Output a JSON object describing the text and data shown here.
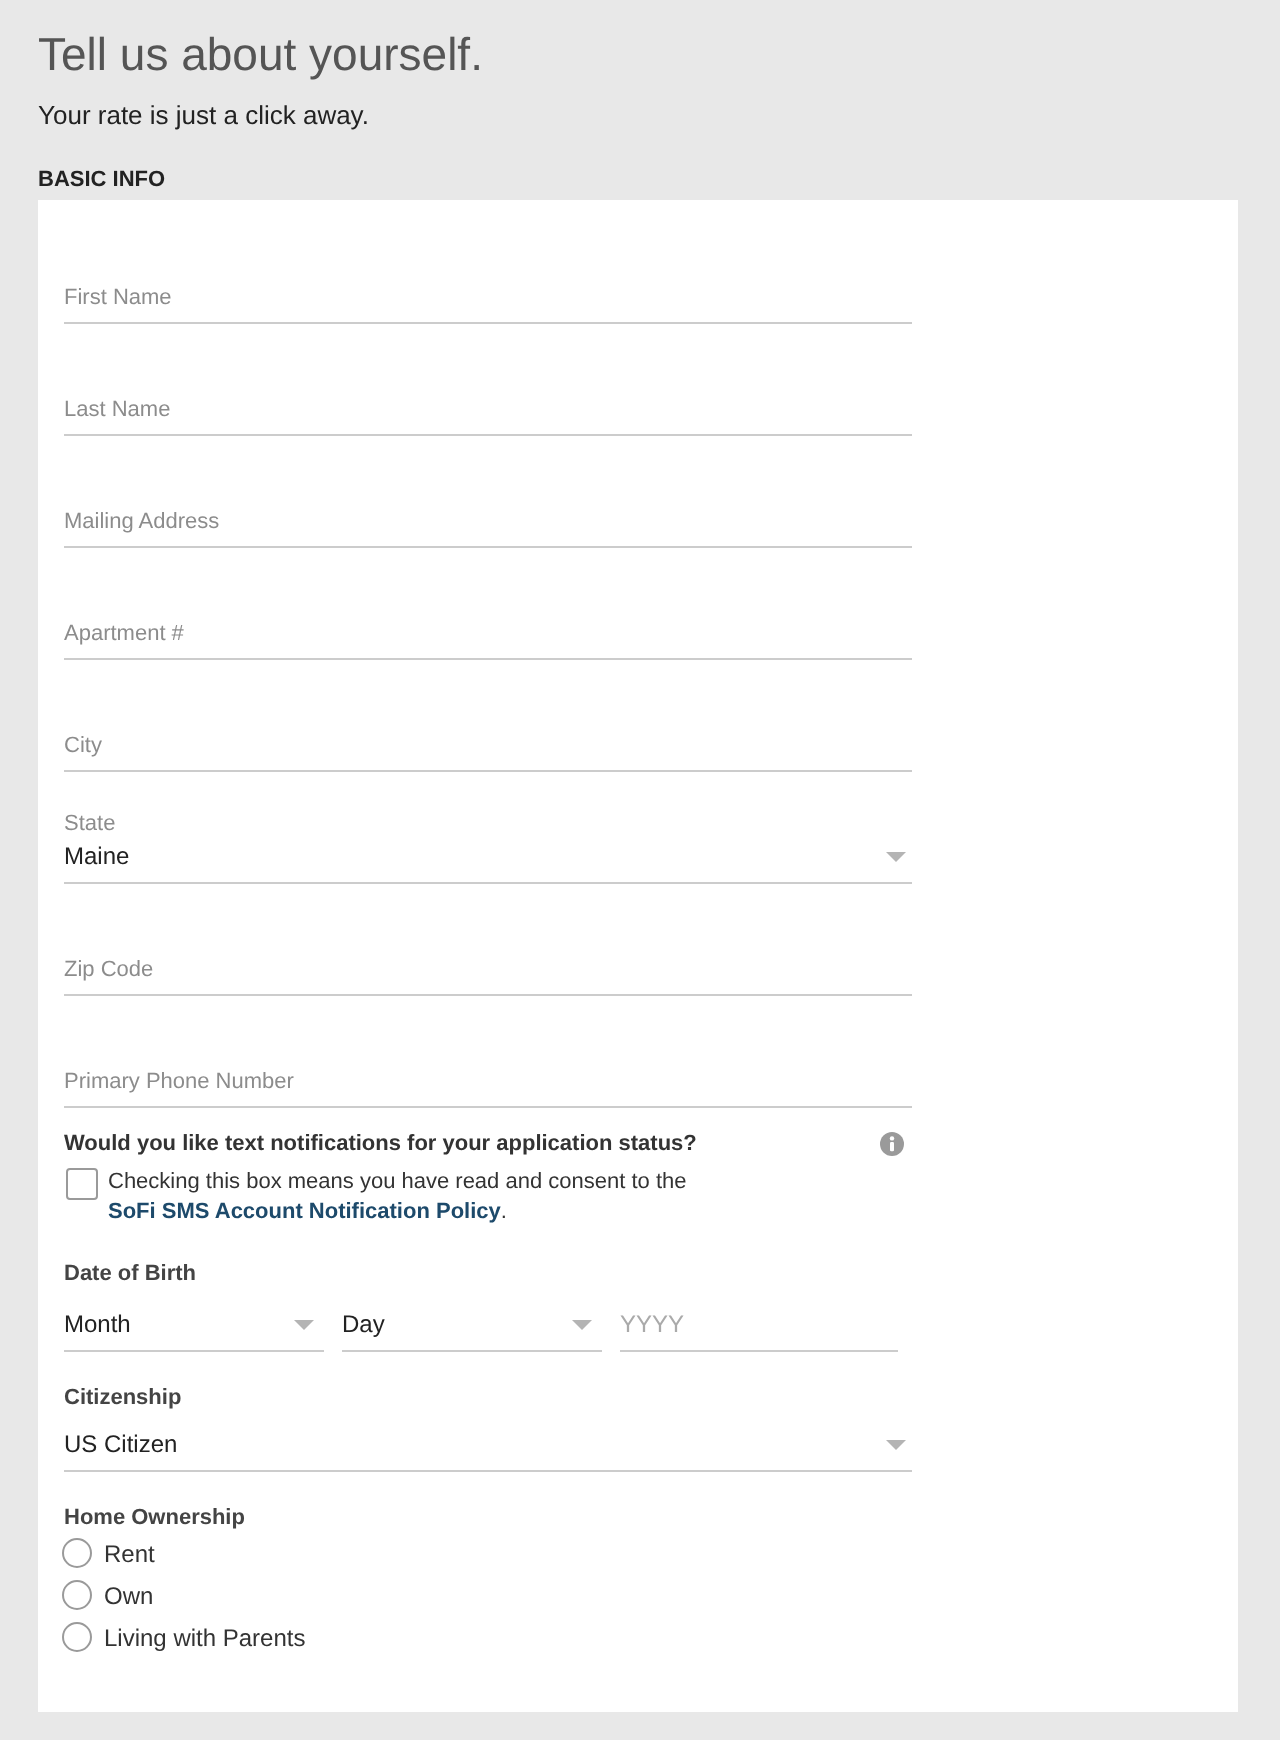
{
  "page": {
    "title": "Tell us about yourself.",
    "subtitle": "Your rate is just a click away."
  },
  "basic_info": {
    "heading": "BASIC INFO",
    "fields": [
      {
        "kind": "text",
        "placeholder": "First Name"
      },
      {
        "kind": "text",
        "placeholder": "Last Name"
      },
      {
        "kind": "text",
        "placeholder": "Mailing Address"
      },
      {
        "kind": "text",
        "placeholder": "Apartment #"
      },
      {
        "kind": "text",
        "placeholder": "City"
      },
      {
        "kind": "select",
        "label": "State",
        "value": "Maine"
      },
      {
        "kind": "text",
        "placeholder": "Zip Code"
      },
      {
        "kind": "text",
        "placeholder": "Primary Phone Number"
      }
    ],
    "sms_notifications": {
      "question": "Would you like text notifications for your application status?",
      "checked": false,
      "consent": "Checking this box means you have read and consent to the",
      "link": "SoFi SMS Account Notification Policy",
      "suffix": "."
    },
    "date_of_birth": {
      "label": "Date of Birth",
      "parts": [
        {
          "kind": "select",
          "value": "Month"
        },
        {
          "kind": "select",
          "value": "Day"
        },
        {
          "kind": "text",
          "placeholder": "YYYY"
        }
      ]
    },
    "citizenship": {
      "label": "Citizenship",
      "value": "US Citizen"
    },
    "home_ownership": {
      "label": "Home Ownership",
      "options": [
        {
          "label": "Rent",
          "selected": false
        },
        {
          "label": "Own",
          "selected": false
        },
        {
          "label": "Living with Parents",
          "selected": false
        }
      ]
    }
  }
}
